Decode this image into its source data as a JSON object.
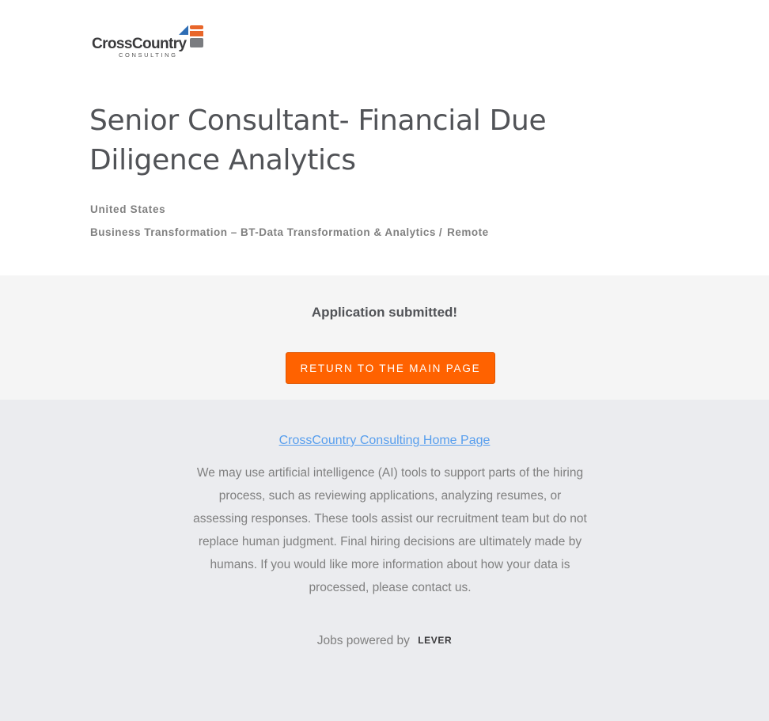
{
  "header": {
    "logo": {
      "wordmark": "CrossCountry",
      "sub": "CONSULTING",
      "colors": {
        "orange": "#e8662a",
        "blue": "#2d6db5",
        "gray": "#7a7c80"
      }
    },
    "job_title": "Senior Consultant- Financial Due Diligence Analytics",
    "location": "United States",
    "category": {
      "department": "Business Transformation – BT-Data Transformation & Analytics",
      "separator": "/",
      "workplace": "Remote"
    }
  },
  "confirmation": {
    "message": "Application submitted!",
    "button_label": "RETURN TO THE MAIN PAGE",
    "button_color": "#ff6200"
  },
  "footer": {
    "home_link": "CrossCountry Consulting Home Page",
    "disclaimer": "We may use artificial intelligence (AI) tools to support parts of the hiring process, such as reviewing applications, analyzing resumes, or assessing responses. These tools assist our recruitment team but do not replace human judgment. Final hiring decisions are ultimately made by humans. If you would like more information about how your data is processed, please contact us.",
    "powered_by": "Jobs powered by",
    "lever_logo": "LEVER"
  }
}
